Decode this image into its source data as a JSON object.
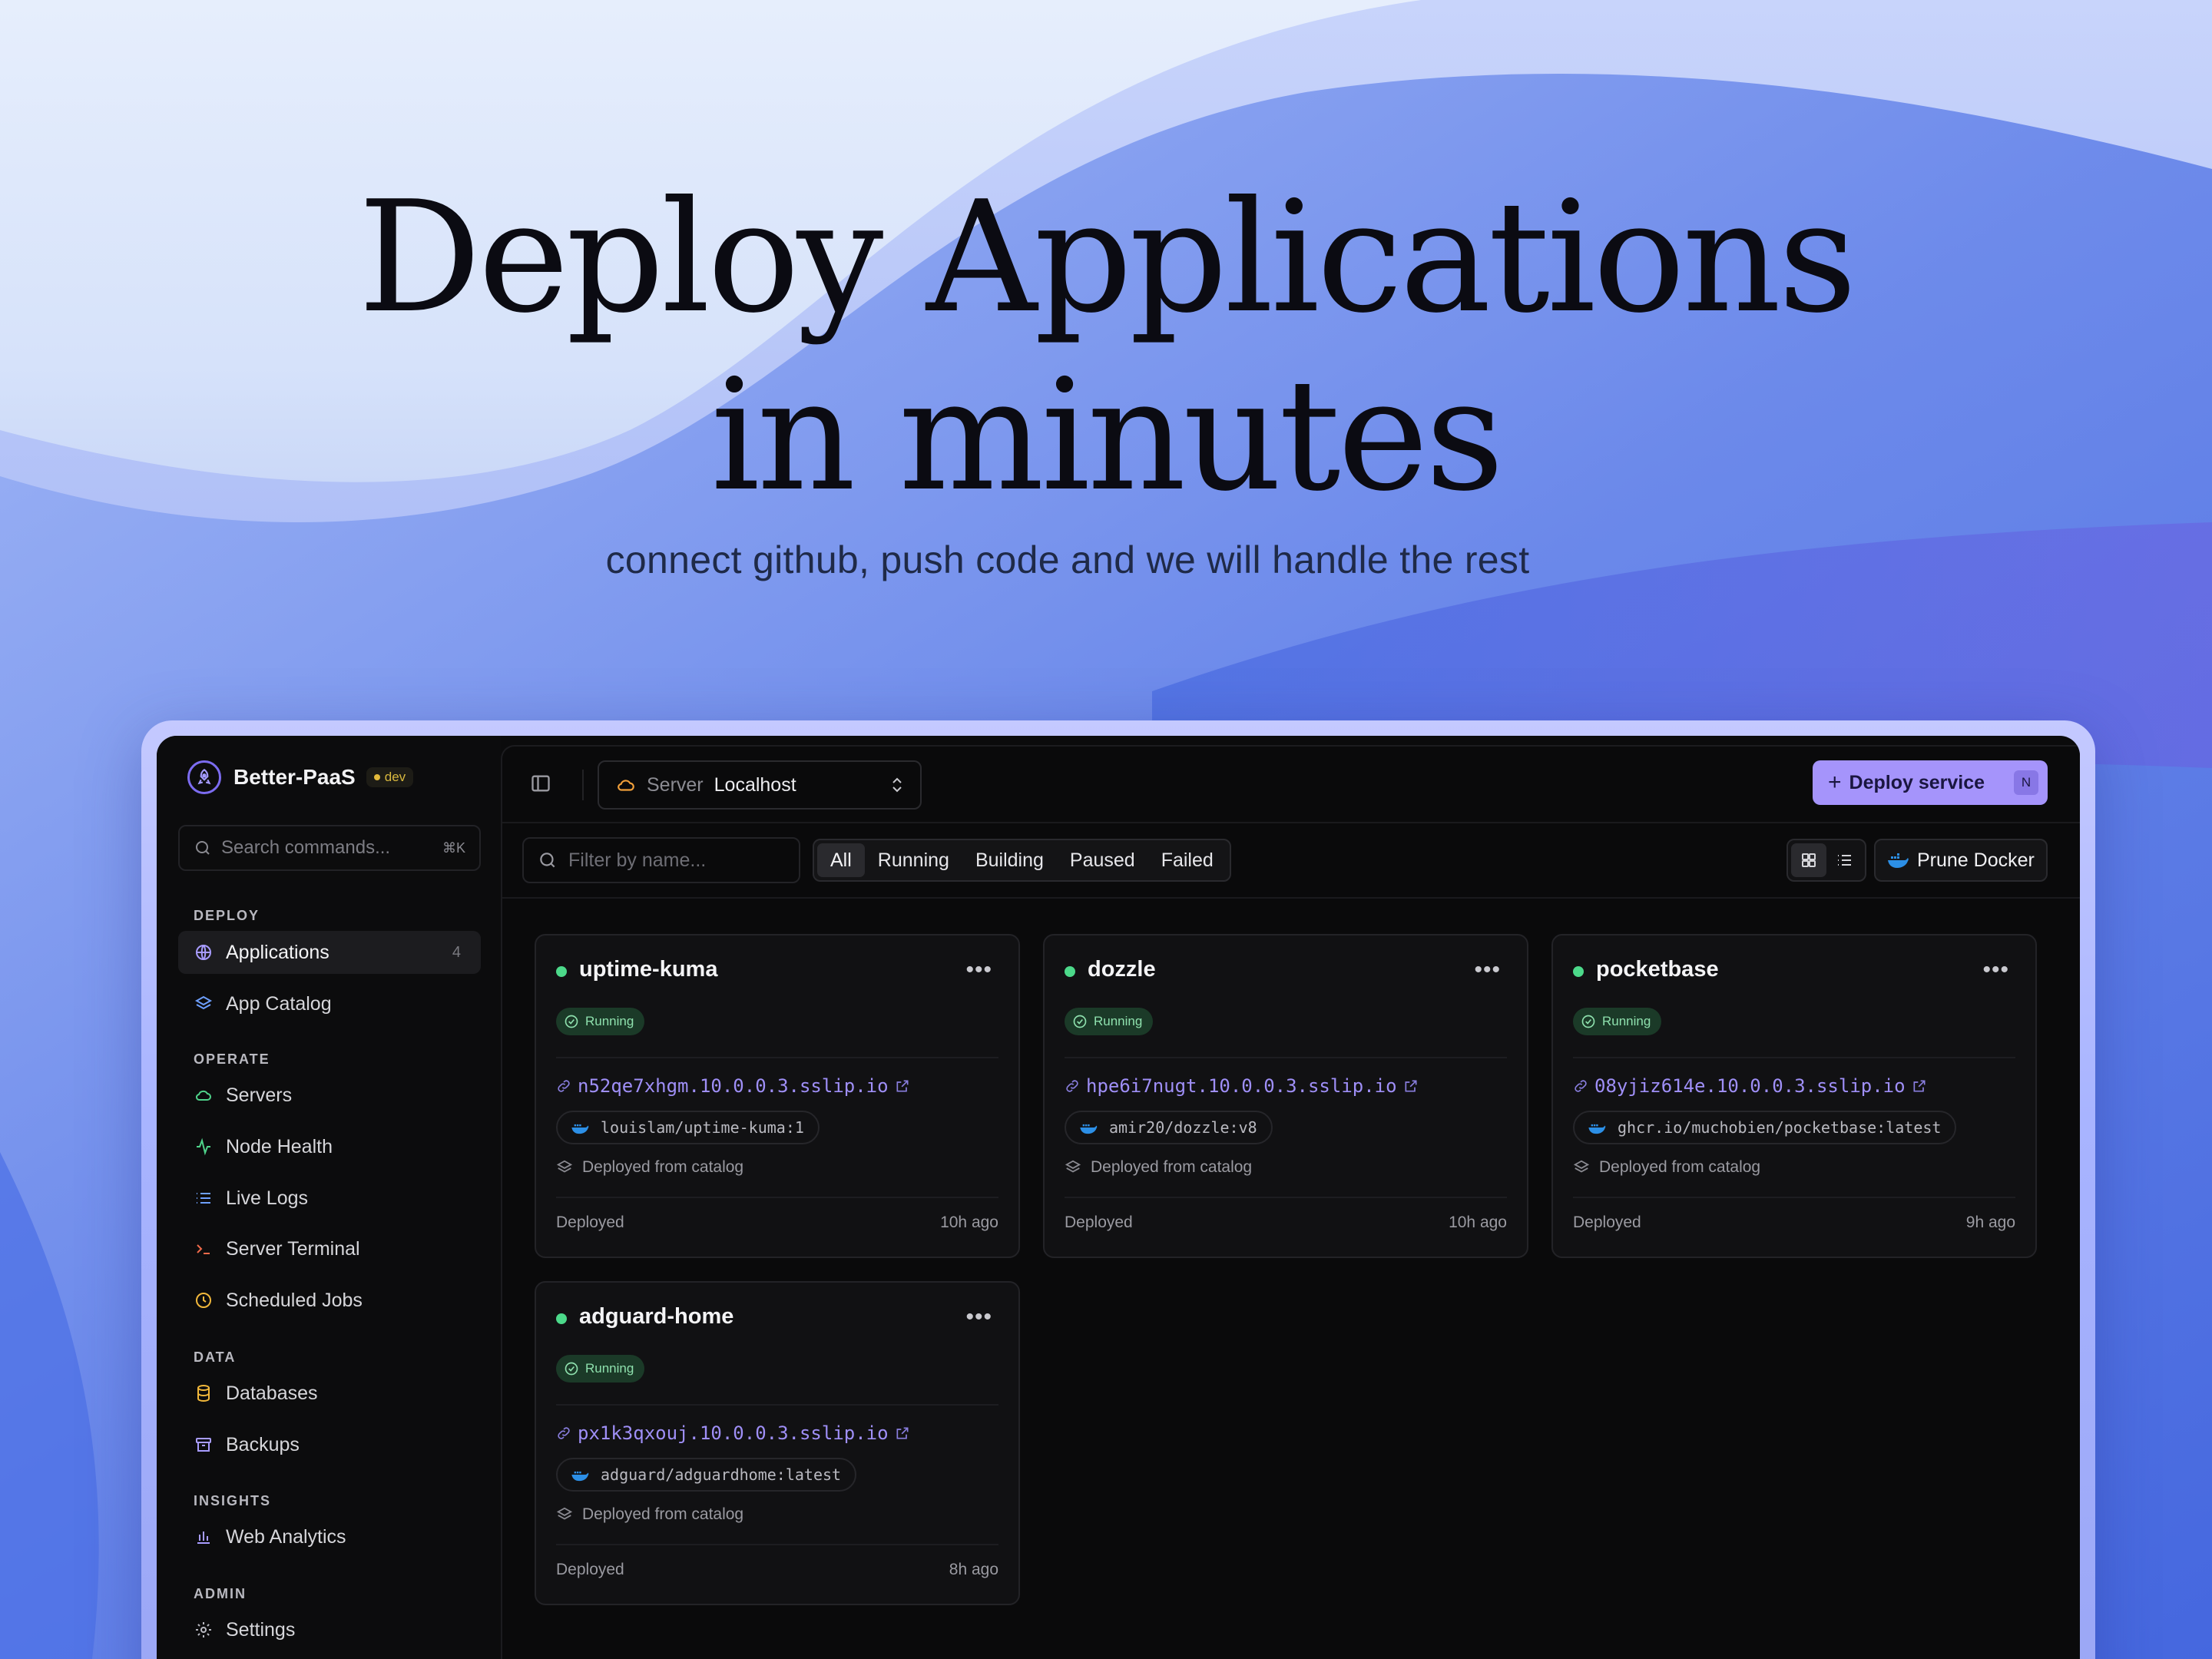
{
  "hero": {
    "headline_line1": "Deploy Applications",
    "headline_line2": "in minutes",
    "subheadline": "connect github, push code and we will handle the rest"
  },
  "colors": {
    "accent": "#a594fb",
    "running_green": "#4cd98a",
    "background_dark": "#0b0b0c",
    "url_purple": "#9f8ff7",
    "dev_yellow": "#e2b93b"
  },
  "sidebar": {
    "brand": {
      "name": "Better-PaaS",
      "badge": "dev",
      "icon": "rocket-logo-icon"
    },
    "search": {
      "placeholder": "Search commands...",
      "shortcut": "⌘K",
      "icon": "search-icon"
    },
    "sections": [
      {
        "title": "DEPLOY",
        "items": [
          {
            "label": "Applications",
            "icon": "globe-icon",
            "count": "4",
            "active": true
          },
          {
            "label": "App Catalog",
            "icon": "layers-icon"
          }
        ]
      },
      {
        "title": "OPERATE",
        "items": [
          {
            "label": "Servers",
            "icon": "cloud-icon"
          },
          {
            "label": "Node Health",
            "icon": "activity-icon"
          },
          {
            "label": "Live Logs",
            "icon": "list-icon"
          },
          {
            "label": "Server Terminal",
            "icon": "terminal-icon"
          },
          {
            "label": "Scheduled Jobs",
            "icon": "clock-icon"
          }
        ]
      },
      {
        "title": "DATA",
        "items": [
          {
            "label": "Databases",
            "icon": "database-icon"
          },
          {
            "label": "Backups",
            "icon": "archive-icon"
          }
        ]
      },
      {
        "title": "INSIGHTS",
        "items": [
          {
            "label": "Web Analytics",
            "icon": "bar-chart-icon"
          }
        ]
      },
      {
        "title": "ADMIN",
        "items": [
          {
            "label": "Settings",
            "icon": "gear-icon"
          }
        ]
      }
    ]
  },
  "topbar": {
    "server_label": "Server",
    "server_value": "Localhost",
    "deploy_button": "Deploy service",
    "deploy_shortcut": "N"
  },
  "filters": {
    "placeholder": "Filter by name...",
    "tabs": [
      "All",
      "Running",
      "Building",
      "Paused",
      "Failed"
    ],
    "active_tab": "All",
    "view_modes": [
      "grid",
      "list"
    ],
    "active_view": "grid",
    "prune_button": "Prune Docker"
  },
  "apps": [
    {
      "name": "uptime-kuma",
      "status": "Running",
      "url": "n52qe7xhgm.10.0.0.3.sslip.io",
      "image": "louislam/uptime-kuma:1",
      "source": "Deployed from catalog",
      "state": "Deployed",
      "age": "10h ago"
    },
    {
      "name": "dozzle",
      "status": "Running",
      "url": "hpe6i7nugt.10.0.0.3.sslip.io",
      "image": "amir20/dozzle:v8",
      "source": "Deployed from catalog",
      "state": "Deployed",
      "age": "10h ago"
    },
    {
      "name": "pocketbase",
      "status": "Running",
      "url": "08yjiz614e.10.0.0.3.sslip.io",
      "image": "ghcr.io/muchobien/pocketbase:latest",
      "source": "Deployed from catalog",
      "state": "Deployed",
      "age": "9h ago"
    },
    {
      "name": "adguard-home",
      "status": "Running",
      "url": "px1k3qxouj.10.0.0.3.sslip.io",
      "image": "adguard/adguardhome:latest",
      "source": "Deployed from catalog",
      "state": "Deployed",
      "age": "8h ago"
    }
  ]
}
